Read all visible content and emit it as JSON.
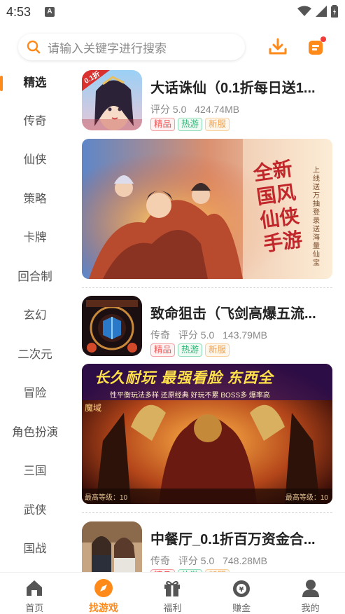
{
  "status": {
    "time": "4:53",
    "a_badge": "A"
  },
  "search": {
    "placeholder": "请输入关键字进行搜索"
  },
  "sidebar": {
    "items": [
      {
        "label": "精选"
      },
      {
        "label": "传奇"
      },
      {
        "label": "仙侠"
      },
      {
        "label": "策略"
      },
      {
        "label": "卡牌"
      },
      {
        "label": "回合制"
      },
      {
        "label": "玄幻"
      },
      {
        "label": "二次元"
      },
      {
        "label": "冒险"
      },
      {
        "label": "角色扮演"
      },
      {
        "label": "三国"
      },
      {
        "label": "武侠"
      },
      {
        "label": "国战"
      }
    ]
  },
  "games": [
    {
      "title": "大话诛仙（0.1折每日送1...",
      "category": "",
      "score": "评分 5.0",
      "size": "424.74MB",
      "icon_badge": "0.1折",
      "tags": [
        "精品",
        "热游",
        "新服"
      ]
    },
    {
      "title": "致命狙击（飞剑高爆五流...",
      "category": "传奇",
      "score": "评分 5.0",
      "size": "143.79MB",
      "tags": [
        "精品",
        "热游",
        "新服"
      ]
    },
    {
      "title": "中餐厅_0.1折百万资金合...",
      "category": "传奇",
      "score": "评分 5.0",
      "size": "748.28MB",
      "tags": [
        "精品",
        "热游",
        "新服"
      ]
    }
  ],
  "banners": [
    {
      "slogan": "全新国风仙侠手游",
      "side_text": "上线送万抽登录送海量仙宝"
    },
    {
      "slogan": "长久耐玩 最强看脸 东西全",
      "subline": "性平衡玩法多样 还原经典 好玩不累 BOSS多 爆率高",
      "corner": "魔域",
      "footer_left": "最高等级：10",
      "footer_right": "最高等级：10"
    }
  ],
  "bottom_nav": [
    {
      "label": "首页",
      "icon": "home-icon"
    },
    {
      "label": "找游戏",
      "icon": "compass-icon"
    },
    {
      "label": "福利",
      "icon": "gift-icon"
    },
    {
      "label": "赚金",
      "icon": "money-bag-icon"
    },
    {
      "label": "我的",
      "icon": "user-icon"
    }
  ],
  "colors": {
    "accent": "#ff8a1a",
    "tag_red": "#e55555",
    "tag_green": "#2bb673",
    "tag_orange": "#f0a04b",
    "dot": "#f23a3a"
  }
}
